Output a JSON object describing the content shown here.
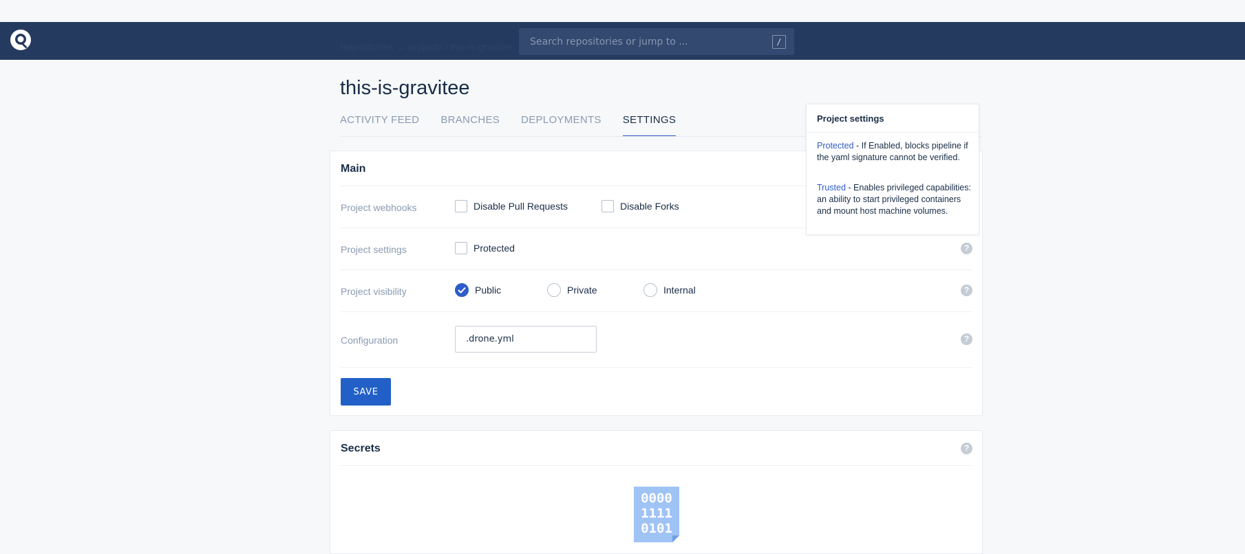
{
  "navbar": {
    "search_placeholder": "Search repositories or jump to ...",
    "search_shortcut": "/",
    "breadcrumb": "Repositories  →  projects / this-is-gravitee"
  },
  "repo": {
    "title": "this-is-gravitee"
  },
  "tabs": [
    {
      "label": "ACTIVITY FEED",
      "active": false
    },
    {
      "label": "BRANCHES",
      "active": false
    },
    {
      "label": "DEPLOYMENTS",
      "active": false
    },
    {
      "label": "SETTINGS",
      "active": true
    }
  ],
  "main": {
    "title": "Main",
    "webhooks": {
      "label": "Project webhooks",
      "options": [
        {
          "label": "Disable Pull Requests",
          "checked": false
        },
        {
          "label": "Disable Forks",
          "checked": false
        }
      ]
    },
    "settings": {
      "label": "Project settings",
      "options": [
        {
          "label": "Protected",
          "checked": false
        }
      ]
    },
    "visibility": {
      "label": "Project visibility",
      "options": [
        {
          "label": "Public",
          "selected": true
        },
        {
          "label": "Private",
          "selected": false
        },
        {
          "label": "Internal",
          "selected": false
        }
      ]
    },
    "configuration": {
      "label": "Configuration",
      "value": ".drone.yml"
    },
    "save_label": "SAVE",
    "help_glyph": "?"
  },
  "secrets": {
    "title": "Secrets",
    "art_lines": [
      "0000",
      "1111",
      "0101"
    ]
  },
  "tooltip": {
    "title": "Project settings",
    "protected_term": "Protected",
    "protected_desc": " - If Enabled, blocks pipeline if the yaml signature cannot be verified.",
    "trusted_term": "Trusted",
    "trusted_desc": " - Enables privileged capabilities: an ability to start privileged containers and mount host machine volumes."
  },
  "colors": {
    "navbar": "#253a5f",
    "accent": "#2e5cc9",
    "save_button": "#2260c8",
    "page_bg": "#f6f8fa"
  }
}
